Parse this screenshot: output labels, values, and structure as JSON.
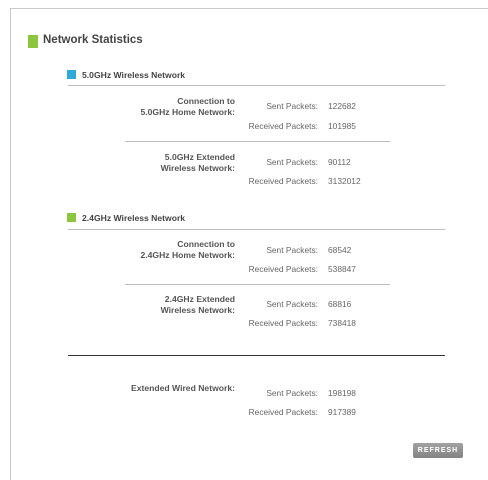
{
  "page_title": "Network Statistics",
  "colors": {
    "title_accent": "#8bc63e",
    "band_5ghz": "#2ea9d8",
    "band_24ghz": "#8bc63e"
  },
  "section_5ghz": {
    "title": "5.0GHz Wireless Network",
    "home": {
      "label": "Connection to\n5.0GHz Home Network:",
      "sent_label": "Sent Packets:",
      "sent": "122682",
      "recv_label": "Received Packets:",
      "recv": "101985"
    },
    "extended": {
      "label": "5.0GHz Extended\nWireless Network:",
      "sent_label": "Sent Packets:",
      "sent": "90112",
      "recv_label": "Received Packets:",
      "recv": "3132012"
    }
  },
  "section_24ghz": {
    "title": "2.4GHz Wireless Network",
    "home": {
      "label": "Connection to\n2.4GHz Home Network:",
      "sent_label": "Sent Packets:",
      "sent": "68542",
      "recv_label": "Received Packets:",
      "recv": "538847"
    },
    "extended": {
      "label": "2.4GHz Extended\nWireless Network:",
      "sent_label": "Sent Packets:",
      "sent": "68816",
      "recv_label": "Received Packets:",
      "recv": "738418"
    }
  },
  "wired": {
    "label": "Extended Wired Network:",
    "sent_label": "Sent Packets:",
    "sent": "198198",
    "recv_label": "Received Packets:",
    "recv": "917389"
  },
  "refresh_label": "REFRESH"
}
